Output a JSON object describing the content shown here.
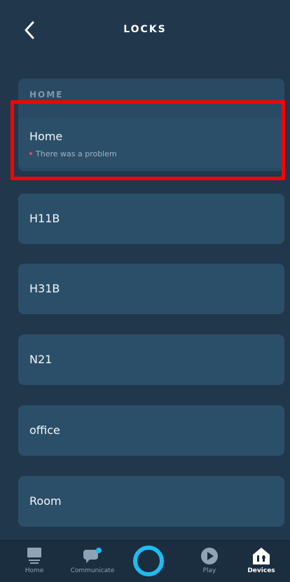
{
  "header": {
    "title": "LOCKS"
  },
  "group": {
    "label": "HOME"
  },
  "locks": [
    {
      "name": "Home",
      "status": "There was a problem"
    },
    {
      "name": "H11B"
    },
    {
      "name": "H31B"
    },
    {
      "name": "N21"
    },
    {
      "name": "office"
    },
    {
      "name": "Room"
    }
  ],
  "tabbar": {
    "home": "Home",
    "communicate": "Communicate",
    "play": "Play",
    "devices": "Devices"
  },
  "colors": {
    "background": "#21374c",
    "card": "#2c4f69",
    "accent": "#1ebcf0",
    "error_dot": "#e5485a",
    "highlight": "#ff0000"
  },
  "icons": [
    "back-chevron-icon",
    "echo-show-icon",
    "chat-bubble-icon",
    "alexa-ring-icon",
    "play-icon",
    "devices-icon"
  ]
}
